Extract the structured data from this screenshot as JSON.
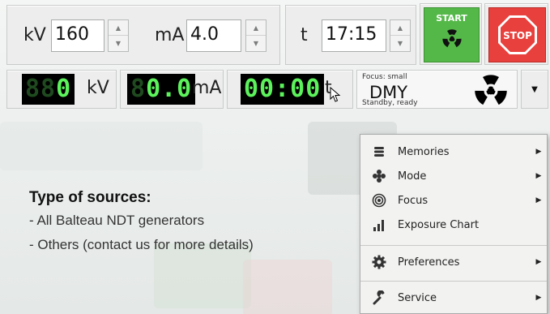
{
  "controls": {
    "kv_label": "kV",
    "kv_value": "160",
    "ma_label": "mA",
    "ma_value": "4.0",
    "t_label": "t",
    "t_hours": "17",
    "t_sep": ":",
    "t_minutes": "15",
    "start_label": "START",
    "stop_label": "STOP"
  },
  "displays": {
    "kv_dim": "88",
    "kv_lit": "0",
    "kv_unit": "kV",
    "ma_dim": "8",
    "ma_lit": "0.0",
    "ma_unit": "mA",
    "t_lit": "00:00",
    "t_unit": "t"
  },
  "status": {
    "focus": "Focus: small",
    "device": "DMY",
    "state": "Standby, ready"
  },
  "info": {
    "title": "Type of sources:",
    "lines": [
      "- All Balteau NDT generators",
      "- Others (contact us for more details)"
    ]
  },
  "menu": {
    "items": [
      {
        "label": "Memories",
        "icon": "database-icon",
        "submenu": true
      },
      {
        "label": "Mode",
        "icon": "mode-icon",
        "submenu": true
      },
      {
        "label": "Focus",
        "icon": "focus-icon",
        "submenu": true
      },
      {
        "label": "Exposure Chart",
        "icon": "bar-chart-icon",
        "submenu": false
      },
      {
        "label": "Preferences",
        "icon": "gear-icon",
        "submenu": true
      },
      {
        "label": "Service",
        "icon": "wrench-icon",
        "submenu": true
      }
    ]
  },
  "colors": {
    "start": "#54b848",
    "stop": "#e8403c",
    "lcd_lit": "#5cf25c",
    "lcd_dim": "#1f4a1f"
  }
}
